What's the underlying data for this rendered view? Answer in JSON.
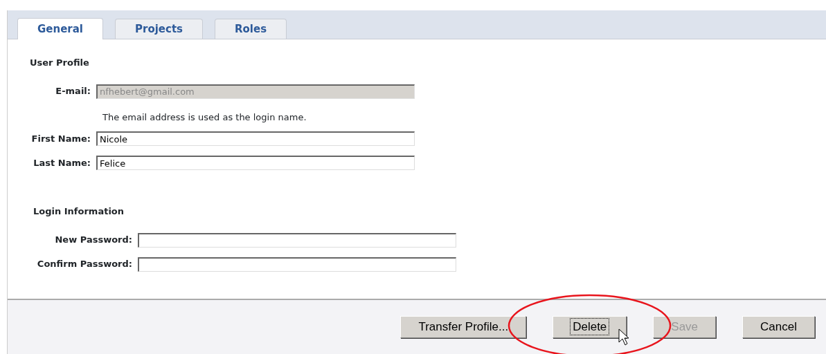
{
  "tabs": [
    {
      "label": "General",
      "selected": true
    },
    {
      "label": "Projects",
      "selected": false
    },
    {
      "label": "Roles",
      "selected": false
    }
  ],
  "sections": [
    {
      "title": "User Profile",
      "fields": [
        {
          "label": "E-mail:",
          "value": "nfhebert@gmail.com",
          "disabled": true,
          "help": "The email address is used as the login name."
        },
        {
          "label": "First Name:",
          "value": "Nicole",
          "disabled": false
        },
        {
          "label": "Last Name:",
          "value": "Felice",
          "disabled": false
        }
      ]
    },
    {
      "title": "Login Information",
      "fields": [
        {
          "label": "New Password:",
          "disabled": false
        },
        {
          "label": "Confirm Password:",
          "disabled": false
        }
      ]
    }
  ],
  "buttons": [
    {
      "label": "Transfer Profile...",
      "disabled": false,
      "focused": false,
      "circled": false
    },
    {
      "label": "Delete",
      "disabled": false,
      "focused": true,
      "circled": true
    },
    {
      "label": "Save",
      "disabled": true,
      "focused": false,
      "circled": false
    },
    {
      "label": "Cancel",
      "disabled": false,
      "focused": false,
      "circled": false
    }
  ]
}
